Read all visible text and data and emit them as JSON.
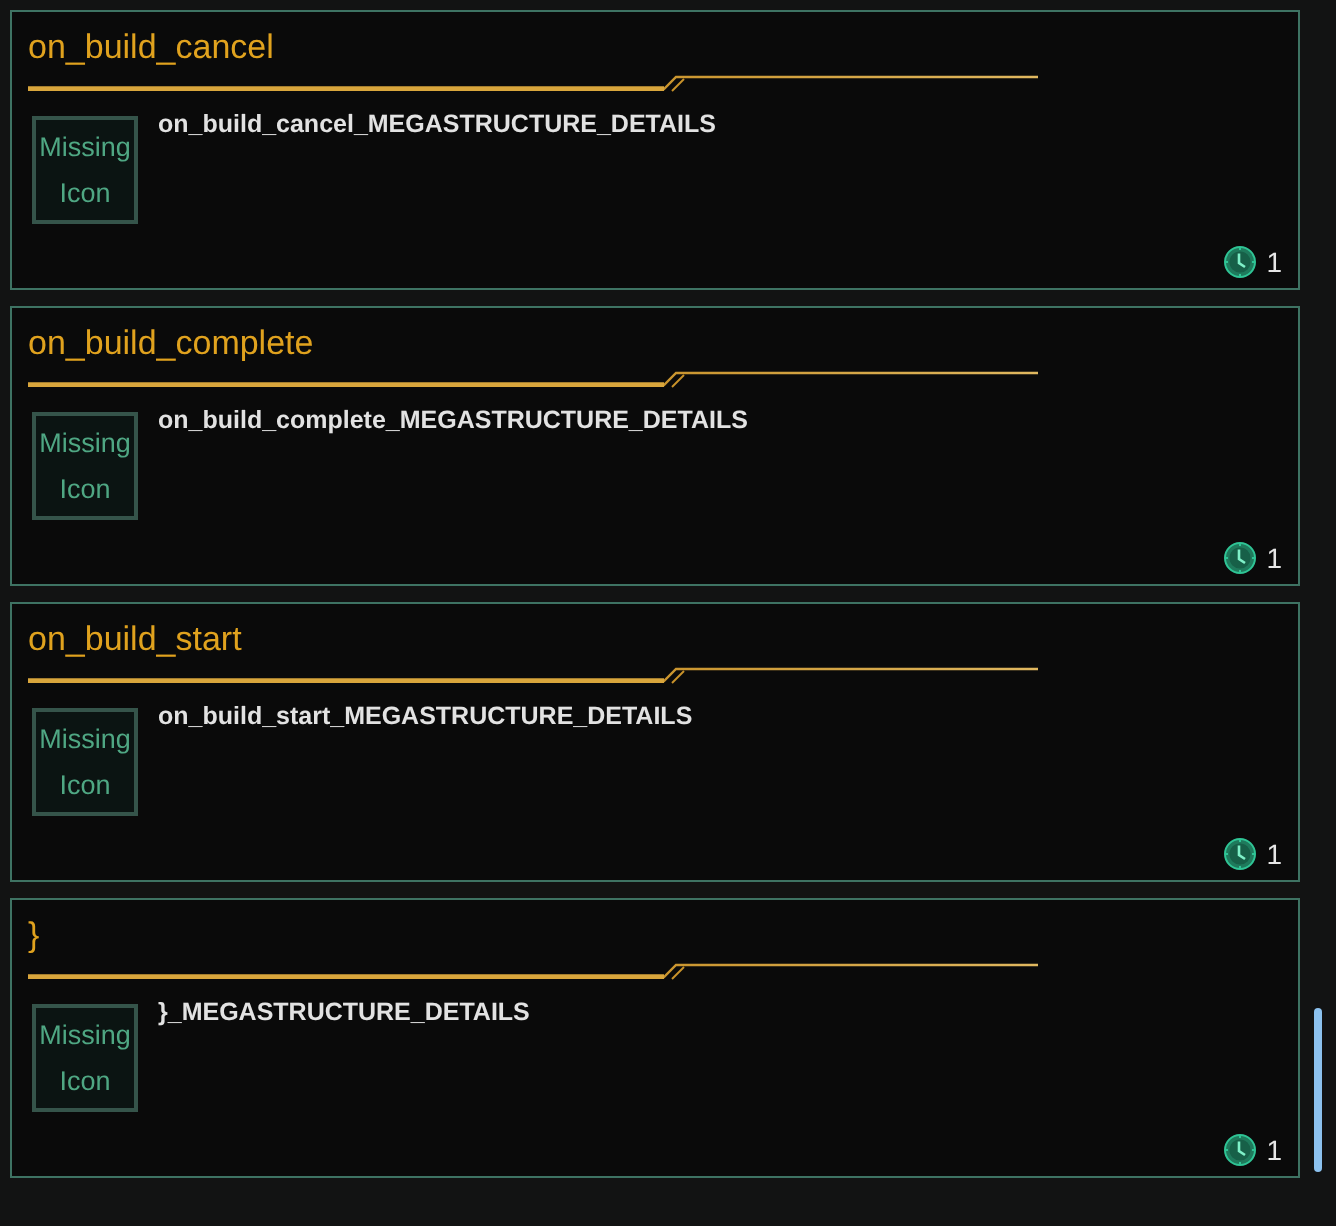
{
  "events": [
    {
      "title": "on_build_cancel",
      "icon_label": "Missing Icon",
      "details": "on_build_cancel_MEGASTRUCTURE_DETAILS",
      "count": "1"
    },
    {
      "title": "on_build_complete",
      "icon_label": "Missing Icon",
      "details": "on_build_complete_MEGASTRUCTURE_DETAILS",
      "count": "1"
    },
    {
      "title": "on_build_start",
      "icon_label": "Missing Icon",
      "details": "on_build_start_MEGASTRUCTURE_DETAILS",
      "count": "1"
    },
    {
      "title": "}",
      "icon_label": "Missing Icon",
      "details": "}_MEGASTRUCTURE_DETAILS",
      "count": "1"
    }
  ]
}
